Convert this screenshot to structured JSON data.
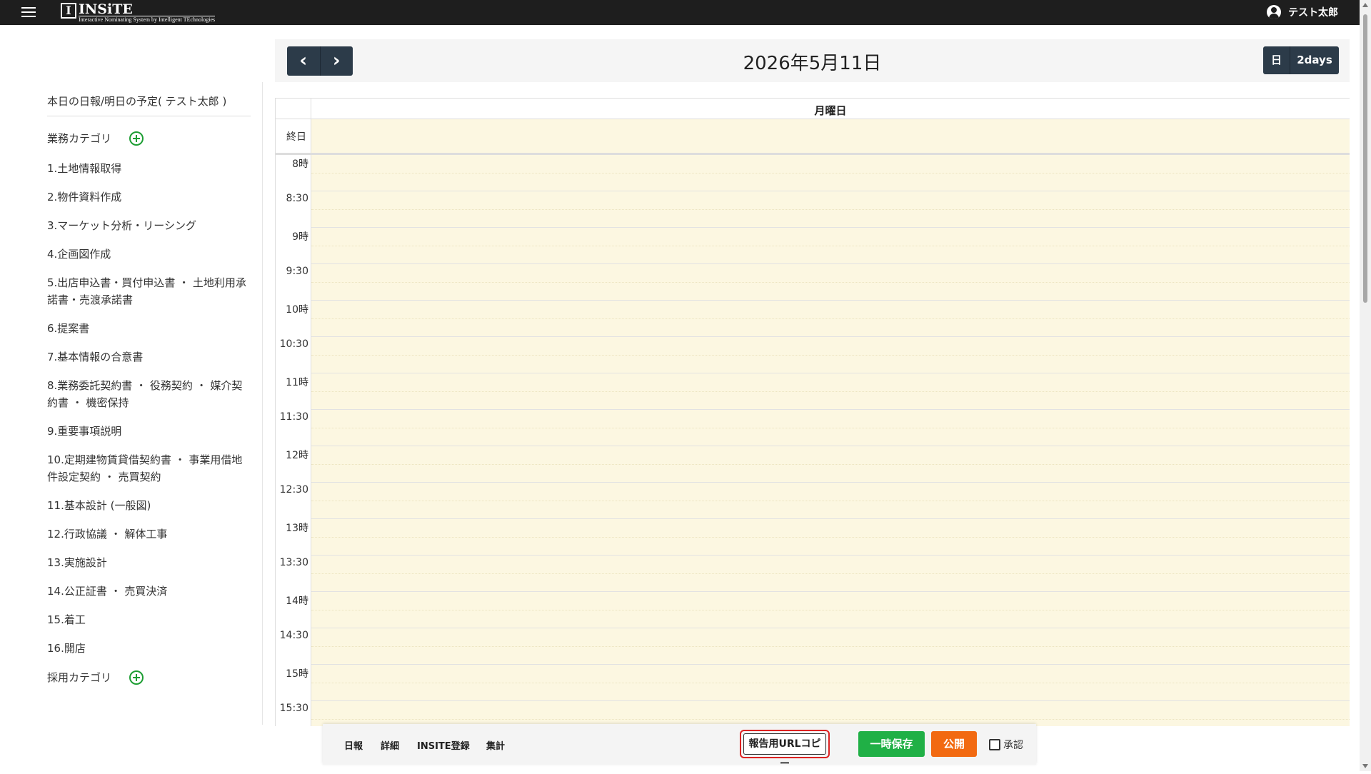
{
  "header": {
    "logo_mark": "I",
    "logo_name": "INSiTE",
    "logo_subtitle": "Interactive Nominating System by Intelligent TEchnologies",
    "user_name": "テスト太郎"
  },
  "calendar": {
    "prev_label": "‹",
    "next_label": "›",
    "date": "2026年5月11日",
    "view_day": "日",
    "view_2days": "2days",
    "day_name": "月曜日",
    "allday_label": "終日",
    "times": [
      "8時",
      "8:30",
      "9時",
      "9:30",
      "10時",
      "10:30",
      "11時",
      "11:30",
      "12時",
      "12:30",
      "13時",
      "13:30",
      "14時",
      "14:30",
      "15時",
      "15:30"
    ]
  },
  "sidebar": {
    "title": "本日の日報/明日の予定( テスト太郎 )",
    "business_category": "業務カテゴリ",
    "business_items": [
      "1.土地情報取得",
      "2.物件資料作成",
      "3.マーケット分析・リーシング",
      "4.企画図作成",
      "5.出店申込書・買付申込書 ・ 土地利用承諾書・売渡承諾書",
      "6.提案書",
      "7.基本情報の合意書",
      "8.業務委託契約書 ・ 役務契約 ・ 媒介契約書 ・ 機密保持",
      "9.重要事項説明",
      "10.定期建物賃貸借契約書 ・ 事業用借地件設定契約 ・ 売買契約",
      "11.基本設計 (一般図)",
      "12.行政協議 ・ 解体工事",
      "13.実施設計",
      "14.公正証書 ・ 売買決済",
      "15.着工",
      "16.開店"
    ],
    "recruit_category": "採用カテゴリ"
  },
  "toolbar": {
    "daily_report": "日報",
    "details": "詳細",
    "insite_register": "INSITE登録",
    "summary": "集計",
    "copy_url": "報告用URLコピー",
    "temp_save": "一時保存",
    "publish": "公開",
    "approve": "承認"
  },
  "colors": {
    "topbar": "#1e1e1e",
    "nav_button": "#2c3b49",
    "slot_background": "#fcf7e1",
    "save_button": "#20b046",
    "publish_button": "#f26a11",
    "highlight_border": "#dd2222"
  }
}
